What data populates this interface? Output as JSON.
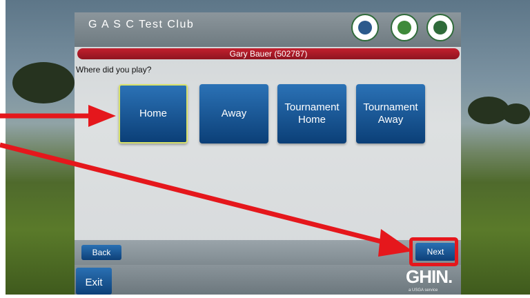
{
  "header": {
    "club_name": "G A S C Test Club"
  },
  "player": {
    "banner": "Gary Bauer (502787)"
  },
  "prompt": {
    "question": "Where did you play?"
  },
  "choices": [
    {
      "label": "Home",
      "selected": true
    },
    {
      "label": "Away",
      "selected": false
    },
    {
      "label": "Tournament\nHome",
      "selected": false
    },
    {
      "label": "Tournament\nAway",
      "selected": false
    }
  ],
  "footer": {
    "back_label": "Back",
    "next_label": "Next",
    "exit_label": "Exit"
  },
  "branding": {
    "ghin": "GHIN.",
    "ghin_sub": "a USGA service"
  },
  "icons": [
    "association-logo-icon",
    "association-logo-icon",
    "association-logo-icon",
    "arrow-right-icon",
    "arrow-right-icon"
  ],
  "colors": {
    "accent_blue": "#0b3f77",
    "banner_red": "#c2202e",
    "annotation_red": "#e5171c",
    "selected_border": "#d9e26a"
  }
}
